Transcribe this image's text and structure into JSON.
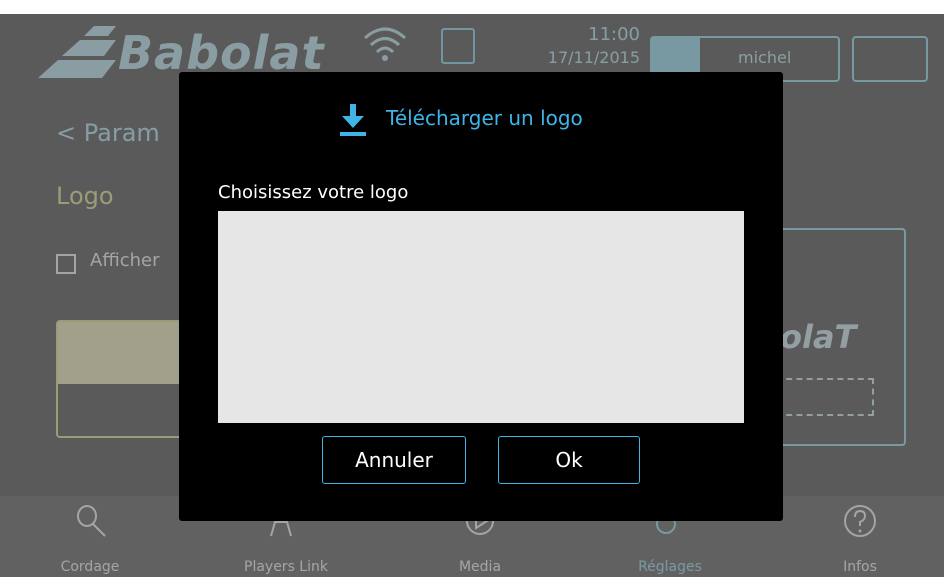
{
  "header": {
    "brand": "Babolat",
    "time": "11:00",
    "date": "17/11/2015",
    "user_name": "michel"
  },
  "page": {
    "back_title": "< Param",
    "section_title": "Logo",
    "checkbox_label": "Afficher",
    "preview_logo": "olaT"
  },
  "nav": {
    "tabs": [
      {
        "label": "Cordage",
        "icon": "racket-icon"
      },
      {
        "label": "Players Link",
        "icon": "players-icon"
      },
      {
        "label": "Media",
        "icon": "play-icon"
      },
      {
        "label": "Réglages",
        "icon": "gears-icon",
        "active": true
      },
      {
        "label": "Infos",
        "icon": "question-icon"
      }
    ]
  },
  "dialog": {
    "title": "Télécharger un logo",
    "prompt": "Choisissez votre logo",
    "cancel_label": "Annuler",
    "ok_label": "Ok"
  },
  "colors": {
    "accent": "#3fb4e6",
    "brand_light": "#9fe6fa",
    "yellow": "#eeeb9a",
    "overlay_bg": "#5a5a5a",
    "dialog_bg": "#000000"
  }
}
